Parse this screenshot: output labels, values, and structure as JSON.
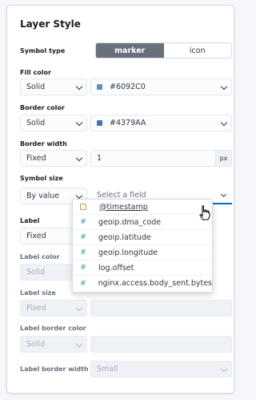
{
  "title": "Layer Style",
  "symbol_type": {
    "label": "Symbol type",
    "options": [
      "marker",
      "icon"
    ],
    "selected": "marker"
  },
  "fill_color": {
    "label": "Fill color",
    "mode": "Solid",
    "value": "#6092C0",
    "swatch": "#6092C0"
  },
  "border_color": {
    "label": "Border color",
    "mode": "Solid",
    "value": "#4379AA",
    "swatch": "#4379AA"
  },
  "border_width": {
    "label": "Border width",
    "mode": "Fixed",
    "value": "1",
    "unit": "px"
  },
  "symbol_size": {
    "label": "Symbol size",
    "mode": "By value",
    "placeholder": "Select a field"
  },
  "field_options": [
    {
      "name": "@timestamp",
      "type": "date"
    },
    {
      "name": "geoip.dma_code",
      "type": "number"
    },
    {
      "name": "geoip.latitude",
      "type": "number"
    },
    {
      "name": "geoip.longitude",
      "type": "number"
    },
    {
      "name": "log.offset",
      "type": "number"
    },
    {
      "name": "nginx.access.body_sent.bytes",
      "type": "number"
    }
  ],
  "number_icon": "#",
  "label": {
    "label": "Label",
    "mode": "Fixed"
  },
  "label_color": {
    "label": "Label color",
    "mode": "Solid"
  },
  "label_size": {
    "label": "Label size",
    "mode": "Fixed"
  },
  "label_border_color": {
    "label": "Label border color",
    "mode": "Solid"
  },
  "label_border_width": {
    "label": "Label border width",
    "value": "Small"
  },
  "colors": {
    "accent": "#0071c2",
    "toggle_on": "#69707d"
  }
}
